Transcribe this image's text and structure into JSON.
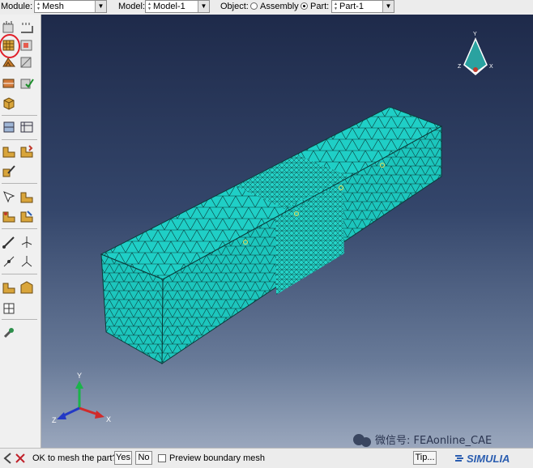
{
  "context_bar": {
    "module_label": "Module:",
    "module_value": "Mesh",
    "model_label": "Model:",
    "model_value": "Model-1",
    "object_label": "Object:",
    "assembly_label": "Assembly",
    "part_radio_label": "Part:",
    "part_value": "Part-1",
    "object_selected": "Part"
  },
  "toolbox": {
    "icons": [
      "seed-part-icon",
      "seed-edge-icon",
      "mesh-part-icon",
      "mesh-region-icon",
      "mesh-controls-icon",
      "element-type-icon",
      "assign-stack-direction-icon",
      "verify-mesh-icon",
      "delete-mesh-icon",
      "partition-cell-icon",
      "partition-face-icon",
      "virtual-topology-icon",
      "query-icon",
      "edit-mesh-icon",
      "create-datum-point-icon",
      "create-datum-axis-icon",
      "create-datum-csys-icon",
      "reference-point-icon",
      "feature-manager-icon",
      "part-instance-icon",
      "adaptivity-icon"
    ],
    "highlight_note_color": "#e0202a"
  },
  "viewport": {
    "background_top": "#1e2a4a",
    "background_bottom": "#9aa7bd",
    "mesh_color": "#1fcfc6",
    "triad_top": {
      "x": "X",
      "y": "Y",
      "z": "Z"
    },
    "triad_bottom": {
      "x": "X",
      "y": "Y",
      "z": "Z"
    }
  },
  "prompt_bar": {
    "message": "OK to mesh the part?",
    "yes_label": "Yes",
    "no_label": "No",
    "preview_label": "Preview boundary mesh",
    "preview_checked": false,
    "tip_label": "Tip..."
  },
  "branding": {
    "wechat_text": "微信号: FEAonline_CAE",
    "logo_text": "SIMULIA"
  }
}
